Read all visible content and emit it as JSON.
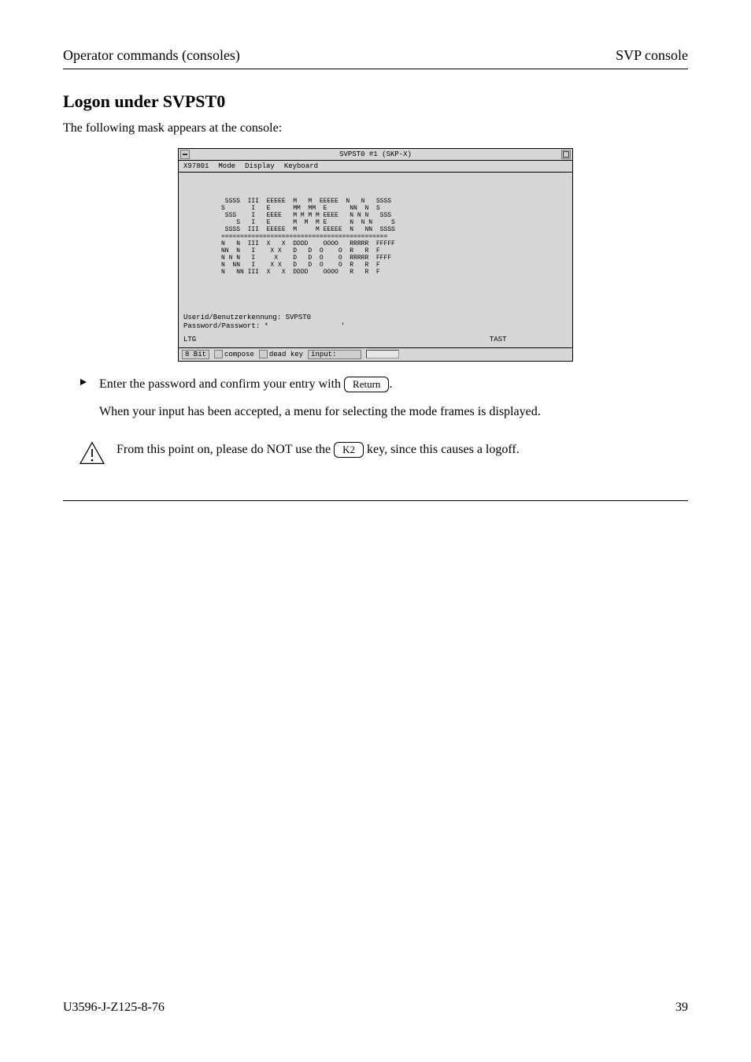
{
  "header": {
    "left": "Operator commands (consoles)",
    "right": "SVP console"
  },
  "section_title": "Logon under SVPST0",
  "intro_paragraph": "The following mask appears at the console:",
  "terminal": {
    "title": "SVPST0 #1 (SKP-X)",
    "menubar": [
      "X97801",
      "Mode",
      "Display",
      "Keyboard"
    ],
    "ascii_art": "           SSSS  III  EEEEE  M   M  EEEEE  N   N   SSSS\n          S       I   E      MM  MM  E      NN  N  S\n           SSS    I   EEEE   M M M M EEEE   N N N   SSS\n              S   I   E      M  M  M E      N  N N     S\n           SSSS  III  EEEEE  M     M EEEEE  N   NN  SSSS\n          ============================================\n          N   N  III  X   X  DDDD    OOOO   RRRRR  FFFFF\n          NN  N   I    X X   D   D  O    O  R   R  F\n          N N N   I     X    D   D  O    O  RRRRR  FFFF\n          N  NN   I    X X   D   D  O    O  R   R  F\n          N   NN III  X   X  DDDD    OOOO   R   R  F",
    "userid_label": "Userid/Benutzerkennung:",
    "userid_value": "SVPST0",
    "password_label": "Password/Passwort:",
    "password_value": "*",
    "status_left": "LTG",
    "status_right": "TAST",
    "statusbar": {
      "bit_label": "8 Bit",
      "compose_label": "compose",
      "deadkey_label": "dead key",
      "input_label": "input:"
    }
  },
  "bullet_text_before": "Enter the password and confirm your entry with ",
  "bullet_key": "Return",
  "bullet_text_after": ".",
  "post_bullet_paragraph": "When your input has been accepted, a menu for selecting the mode frames is displayed.",
  "caution_text_before": "From this point on, please do NOT use the ",
  "caution_key": "K2",
  "caution_text_after": " since this causes a logoff.",
  "footer": {
    "left": "U3596-J-Z125-8-76",
    "right": "39"
  }
}
